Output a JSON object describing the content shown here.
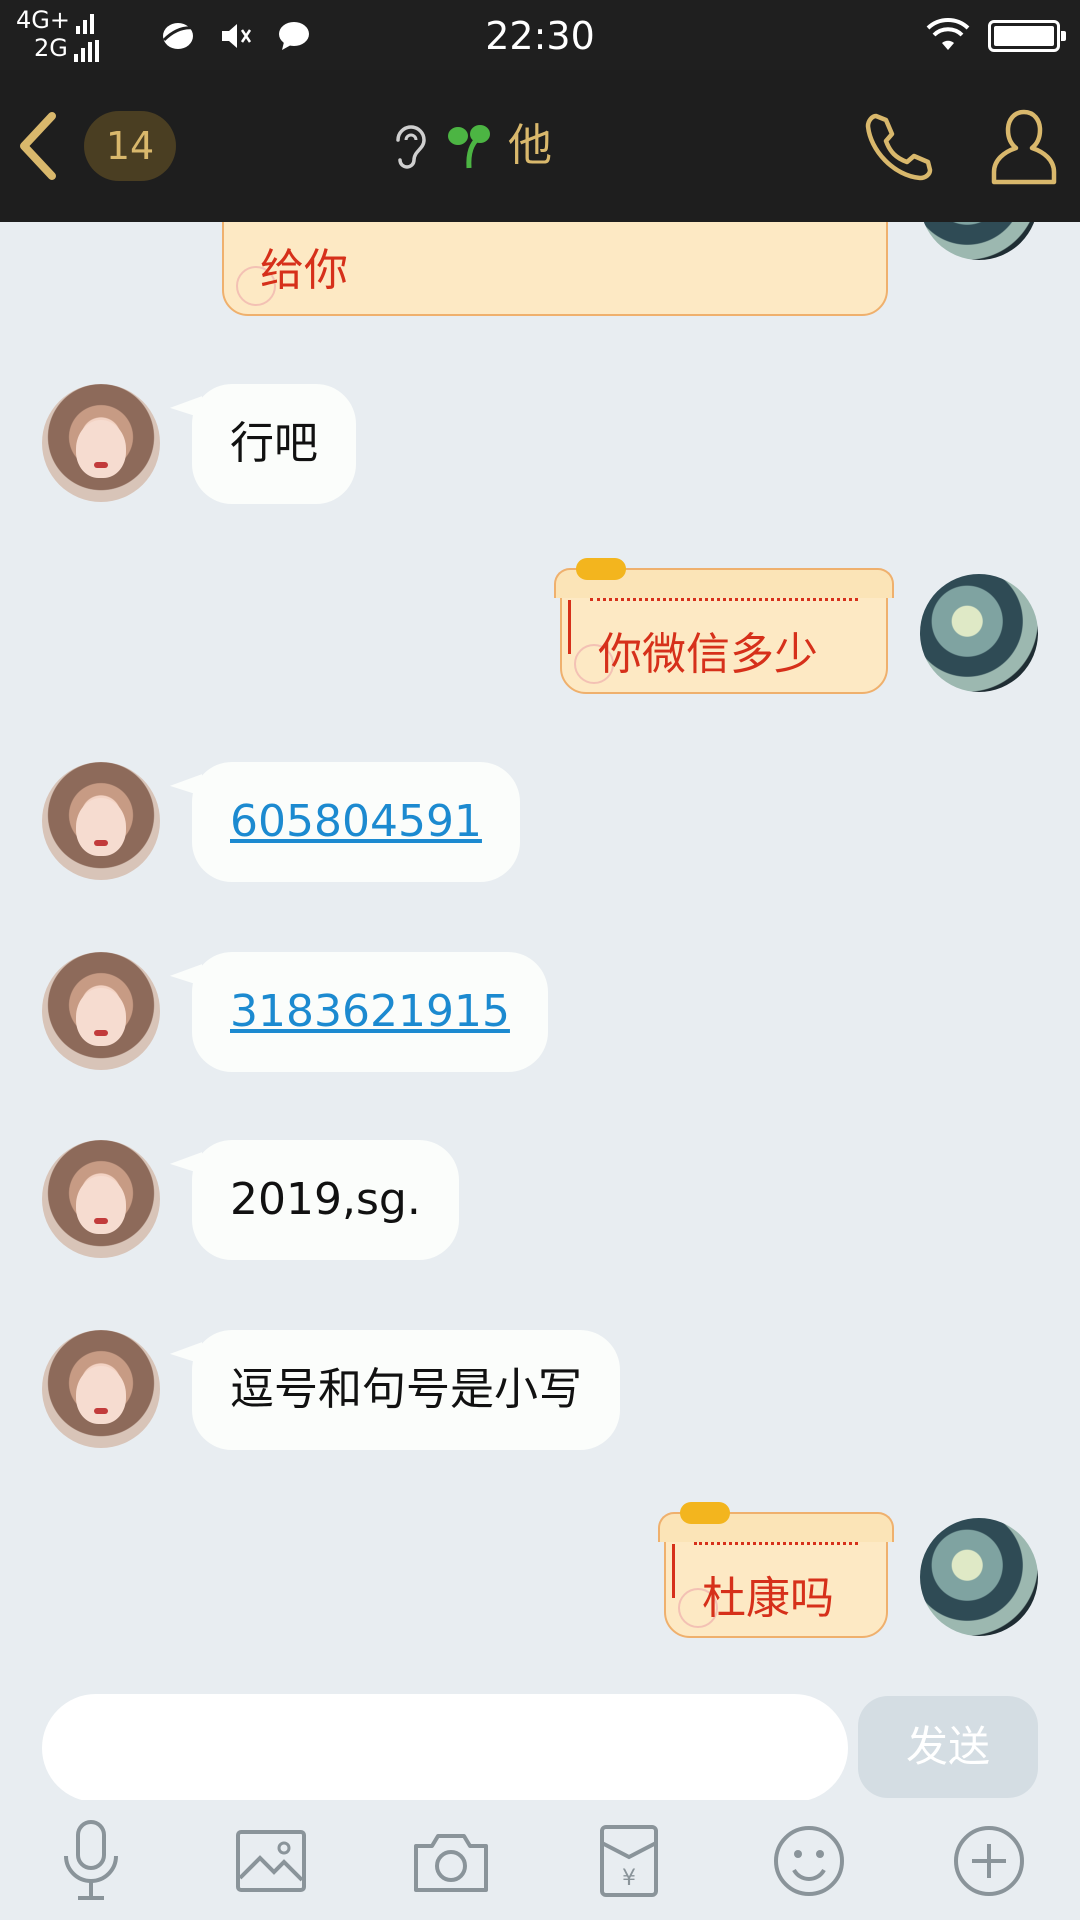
{
  "status_bar": {
    "network_top": "4G+",
    "network_bottom": "2G",
    "time": "22:30",
    "icons": [
      "ie-icon",
      "mute-icon",
      "chat-notification-icon",
      "wifi-icon",
      "battery-icon"
    ]
  },
  "header": {
    "unread_count": "14",
    "title": "他",
    "icons": [
      "back-arrow-icon",
      "ear-icon",
      "sprout-icon",
      "phone-icon",
      "profile-icon"
    ],
    "accent_color": "#d9b86c"
  },
  "messages": [
    {
      "sender": "me",
      "text": "给你",
      "style": "scroll"
    },
    {
      "sender": "her",
      "text": "行吧"
    },
    {
      "sender": "me",
      "text": "你微信多少",
      "style": "scroll"
    },
    {
      "sender": "her",
      "text": "605804591",
      "link": true
    },
    {
      "sender": "her",
      "text": "3183621915",
      "link": true
    },
    {
      "sender": "her",
      "text": "2019,sg."
    },
    {
      "sender": "her",
      "text": "逗号和句号是小写"
    },
    {
      "sender": "me",
      "text": "杜康吗",
      "style": "scroll"
    }
  ],
  "input": {
    "value": "",
    "placeholder": "",
    "send_label": "发送"
  },
  "toolbar": {
    "items": [
      "microphone-icon",
      "image-icon",
      "camera-icon",
      "red-packet-icon",
      "emoji-icon",
      "plus-icon"
    ]
  },
  "colors": {
    "chat_background": "#e8edf1",
    "link": "#1c8ad0",
    "scroll_text": "#d6301a",
    "scroll_bg": "#fde9c4"
  }
}
